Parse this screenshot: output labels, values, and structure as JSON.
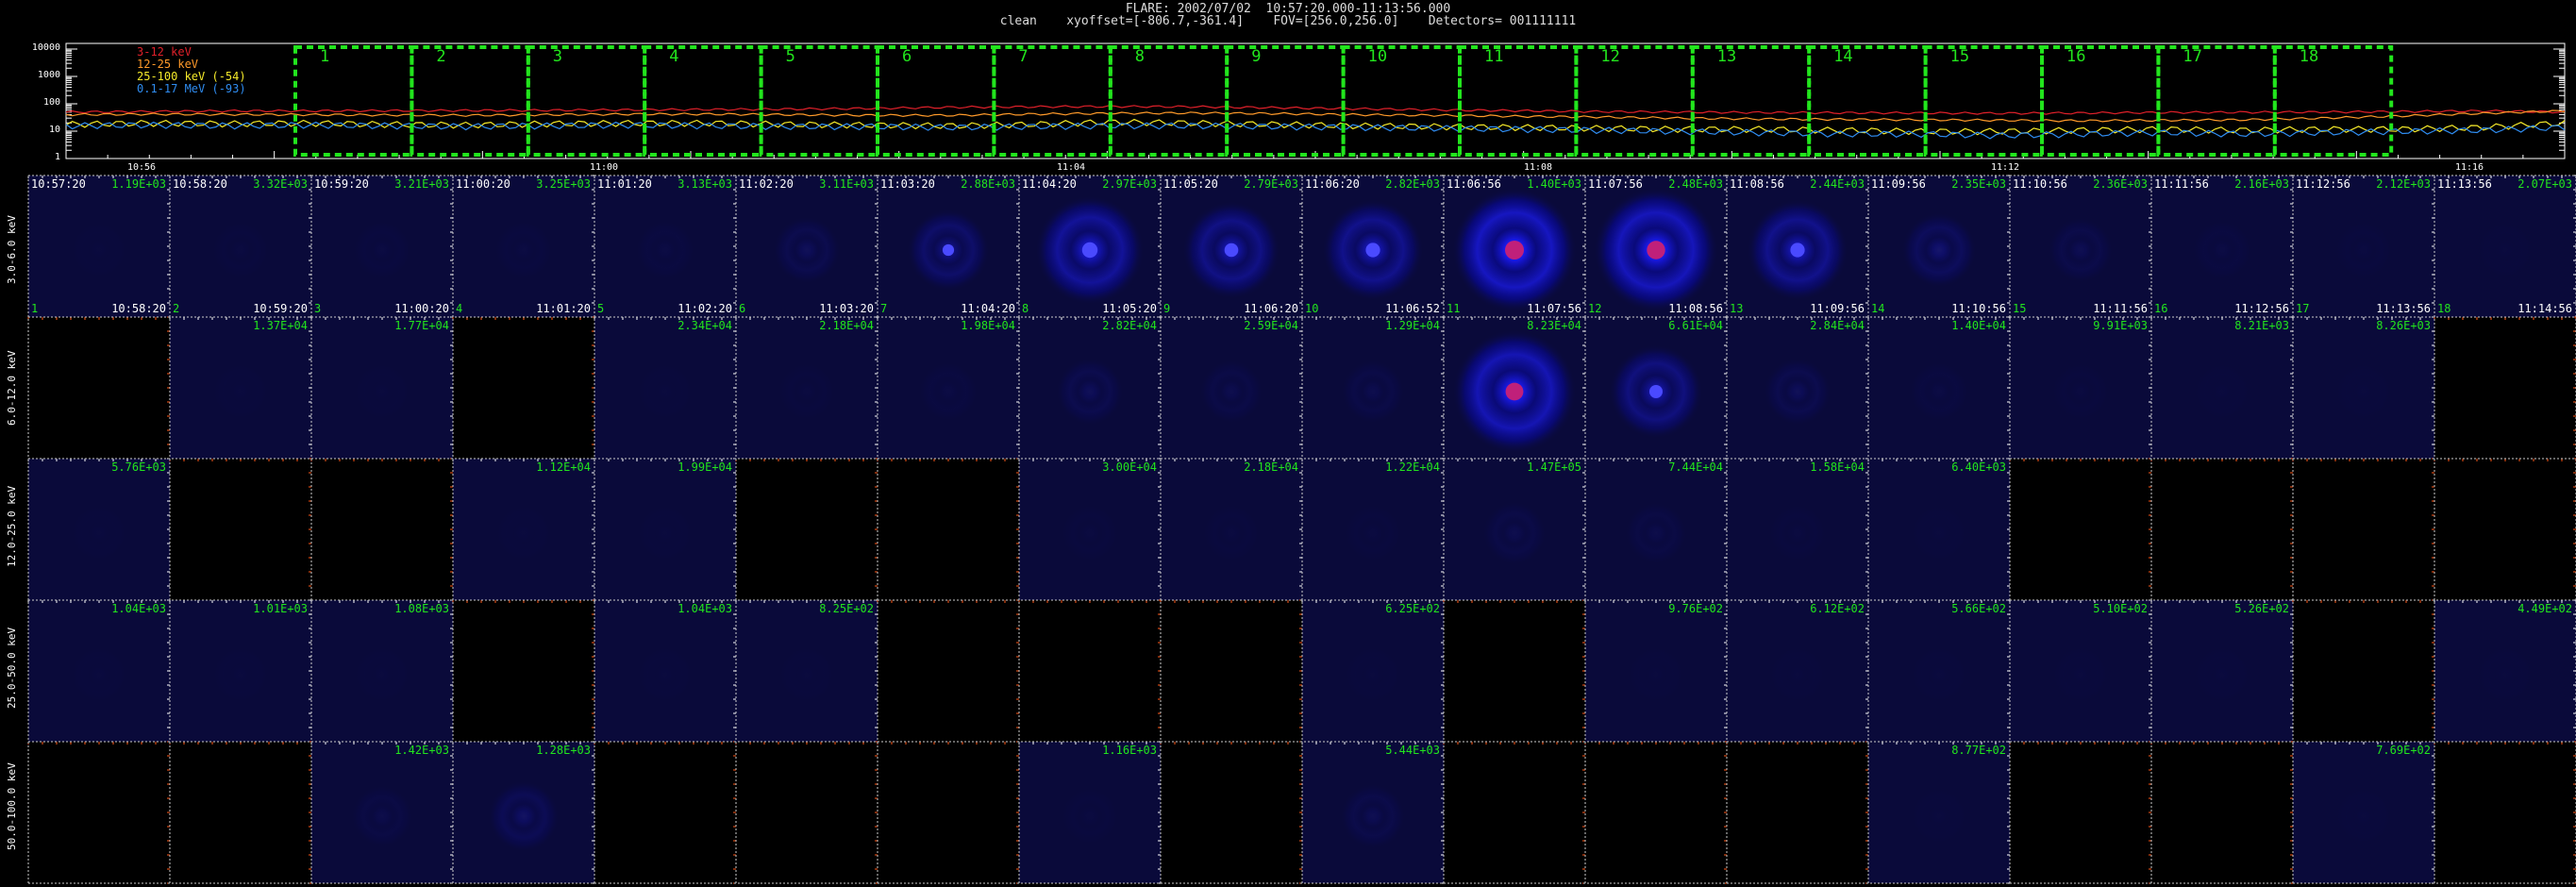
{
  "header": {
    "line1": "FLARE: 2002/07/02  10:57:20.000-11:13:56.000",
    "line2": "clean    xyoffset=[-806.7,-361.4]    FOV=[256.0,256.0]    Detectors= 001111111"
  },
  "lightcurve": {
    "legend": [
      {
        "label": "3-12 keV",
        "color": "#e0202a"
      },
      {
        "label": "12-25 keV",
        "color": "#ff9a2a"
      },
      {
        "label": "25-100 keV (-54)",
        "color": "#f5ea2a"
      },
      {
        "label": "0.1-17 MeV (-93)",
        "color": "#2f8cf0"
      }
    ],
    "y_ticks": [
      "10000",
      "1000",
      "100",
      "10",
      "1"
    ],
    "x_ticks": [
      "10:56",
      "11:00",
      "11:04",
      "11:08",
      "11:12",
      "11:16"
    ],
    "time_range_min": [
      0,
      100
    ],
    "series_levels": [
      {
        "name": "3-12 keV",
        "values": [
          50,
          52,
          55,
          55,
          56,
          57,
          58,
          60,
          62,
          64,
          68,
          75,
          78,
          80,
          78,
          72,
          66,
          60,
          56,
          52,
          50,
          48,
          47,
          46,
          45,
          46,
          48,
          49,
          50,
          52,
          55,
          50
        ]
      },
      {
        "name": "12-25 keV",
        "values": [
          40,
          42,
          41,
          40,
          39,
          38,
          40,
          42,
          42,
          40,
          38,
          38,
          42,
          45,
          46,
          44,
          40,
          38,
          35,
          33,
          30,
          28,
          27,
          26,
          25,
          24,
          25,
          26,
          30,
          36,
          45,
          55
        ]
      },
      {
        "name": "25-100 keV (-54)",
        "values": [
          18,
          20,
          19,
          20,
          18,
          17,
          19,
          20,
          20,
          18,
          17,
          16,
          18,
          22,
          20,
          18,
          16,
          15,
          14,
          13,
          12,
          12,
          11,
          10,
          10,
          11,
          12,
          11,
          12,
          12,
          14,
          20
        ]
      },
      {
        "name": "0.1-17 MeV (-93)",
        "values": [
          16,
          17,
          16,
          17,
          16,
          15,
          16,
          17,
          16,
          15,
          15,
          14,
          15,
          16,
          16,
          15,
          14,
          13,
          12,
          11,
          10,
          9,
          8,
          8,
          7,
          8,
          9,
          8,
          9,
          10,
          11,
          14
        ]
      }
    ],
    "intervals": [
      "1",
      "2",
      "3",
      "4",
      "5",
      "6",
      "7",
      "8",
      "9",
      "10",
      "11",
      "12",
      "13",
      "14",
      "15",
      "16",
      "17",
      "18"
    ]
  },
  "grid": {
    "bands": [
      "3.0-6.0 keV",
      "6.0-12.0 keV",
      "12.0-25.0 keV",
      "25.0-50.0 keV",
      "50.0-100.0 keV"
    ],
    "columns": [
      {
        "start": "10:57:20",
        "end": "10:58:20",
        "num": "1"
      },
      {
        "start": "10:58:20",
        "end": "10:59:20",
        "num": "2"
      },
      {
        "start": "10:59:20",
        "end": "11:00:20",
        "num": "3"
      },
      {
        "start": "11:00:20",
        "end": "11:01:20",
        "num": "4"
      },
      {
        "start": "11:01:20",
        "end": "11:02:20",
        "num": "5"
      },
      {
        "start": "11:02:20",
        "end": "11:03:20",
        "num": "6"
      },
      {
        "start": "11:03:20",
        "end": "11:04:20",
        "num": "7"
      },
      {
        "start": "11:04:20",
        "end": "11:05:20",
        "num": "8"
      },
      {
        "start": "11:05:20",
        "end": "11:06:20",
        "num": "9"
      },
      {
        "start": "11:06:20",
        "end": "11:06:52",
        "num": "10"
      },
      {
        "start": "11:06:56",
        "end": "11:07:56",
        "num": "11"
      },
      {
        "start": "11:07:56",
        "end": "11:08:56",
        "num": "12"
      },
      {
        "start": "11:08:56",
        "end": "11:09:56",
        "num": "13"
      },
      {
        "start": "11:09:56",
        "end": "11:10:56",
        "num": "14"
      },
      {
        "start": "11:10:56",
        "end": "11:11:56",
        "num": "15"
      },
      {
        "start": "11:11:56",
        "end": "11:12:56",
        "num": "16"
      },
      {
        "start": "11:12:56",
        "end": "11:13:56",
        "num": "17"
      },
      {
        "start": "11:13:56",
        "end": "11:14:56",
        "num": "18"
      }
    ],
    "values": [
      [
        "1.19E+03",
        "3.32E+03",
        "3.21E+03",
        "3.25E+03",
        "3.13E+03",
        "3.11E+03",
        "2.88E+03",
        "2.97E+03",
        "2.79E+03",
        "2.82E+03",
        "1.40E+03",
        "2.48E+03",
        "2.44E+03",
        "2.35E+03",
        "2.36E+03",
        "2.16E+03",
        "2.12E+03",
        "2.07E+03"
      ],
      [
        null,
        "1.37E+04",
        "1.77E+04",
        null,
        "2.34E+04",
        "2.18E+04",
        "1.98E+04",
        "2.82E+04",
        "2.59E+04",
        "1.29E+04",
        "8.23E+04",
        "6.61E+04",
        "2.84E+04",
        "1.40E+04",
        "9.91E+03",
        "8.21E+03",
        "8.26E+03",
        null
      ],
      [
        "5.76E+03",
        null,
        null,
        "1.12E+04",
        "1.99E+04",
        null,
        null,
        "3.00E+04",
        "2.18E+04",
        "1.22E+04",
        "1.47E+05",
        "7.44E+04",
        "1.58E+04",
        "6.40E+03",
        null,
        null,
        null,
        null
      ],
      [
        "1.04E+03",
        "1.01E+03",
        "1.08E+03",
        null,
        "1.04E+03",
        "8.25E+02",
        null,
        null,
        null,
        "6.25E+02",
        null,
        "9.76E+02",
        "6.12E+02",
        "5.66E+02",
        "5.10E+02",
        "5.26E+02",
        null,
        "4.49E+02"
      ],
      [
        null,
        null,
        "1.42E+03",
        "1.28E+03",
        null,
        null,
        null,
        "1.16E+03",
        null,
        "5.44E+03",
        null,
        null,
        null,
        "8.77E+02",
        null,
        null,
        "7.69E+02",
        null
      ]
    ],
    "source_intensity": [
      [
        0.02,
        0.03,
        0.04,
        0.04,
        0.05,
        0.15,
        0.35,
        0.7,
        0.55,
        0.6,
        1.0,
        0.95,
        0.6,
        0.25,
        0.12,
        0.05,
        0.03,
        0.02
      ],
      [
        0,
        0.02,
        0.02,
        0,
        0.02,
        0.03,
        0.05,
        0.15,
        0.1,
        0.1,
        0.9,
        0.5,
        0.15,
        0.05,
        0.03,
        0.02,
        0.02,
        0
      ],
      [
        0.02,
        0,
        0,
        0.02,
        0.02,
        0,
        0,
        0.03,
        0.03,
        0.03,
        0.1,
        0.08,
        0.03,
        0.02,
        0,
        0,
        0,
        0
      ],
      [
        0.02,
        0.02,
        0.02,
        0,
        0.02,
        0.02,
        0,
        0,
        0,
        0.02,
        0,
        0.02,
        0.02,
        0.02,
        0.02,
        0.02,
        0,
        0.02
      ],
      [
        0,
        0,
        0.08,
        0.2,
        0,
        0,
        0,
        0.03,
        0,
        0.12,
        0,
        0,
        0,
        0.02,
        0,
        0,
        0.02,
        0
      ]
    ]
  }
}
